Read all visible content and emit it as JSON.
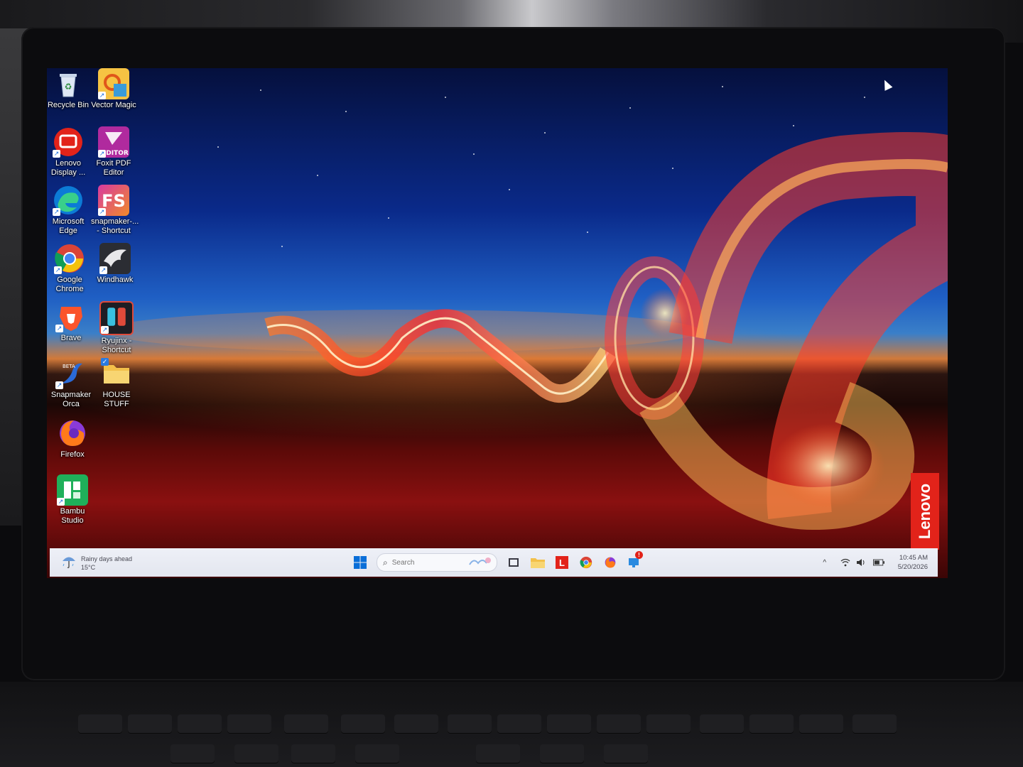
{
  "desktop": {
    "icons": [
      {
        "id": "recycle-bin",
        "label": "Recycle Bin"
      },
      {
        "id": "vector-magic",
        "label": "Vector Magic"
      },
      {
        "id": "lenovo-display",
        "label": "Lenovo Display ..."
      },
      {
        "id": "foxit-pdf-editor",
        "label": "Foxit PDF Editor"
      },
      {
        "id": "microsoft-edge",
        "label": "Microsoft Edge"
      },
      {
        "id": "snapmaker-shortcut",
        "label": "snapmaker-... - Shortcut"
      },
      {
        "id": "google-chrome",
        "label": "Google Chrome"
      },
      {
        "id": "windhawk",
        "label": "Windhawk"
      },
      {
        "id": "brave",
        "label": "Brave"
      },
      {
        "id": "ryujinx-shortcut",
        "label": "Ryujinx - Shortcut"
      },
      {
        "id": "snapmaker-orca",
        "label": "Snapmaker Orca"
      },
      {
        "id": "house-stuff",
        "label": "HOUSE STUFF"
      },
      {
        "id": "firefox",
        "label": "Firefox"
      },
      {
        "id": "bambu-studio",
        "label": "Bambu Studio"
      }
    ],
    "wallpaper_brand": "Lenovo",
    "icon_glyphs": {
      "foxit": "EDITOR",
      "snapmaker": "FS",
      "beta": "BETA"
    }
  },
  "taskbar": {
    "weather": {
      "line1": "Rainy days ahead",
      "line2": "15°C",
      "icon": "umbrella-icon"
    },
    "search_placeholder": "Search",
    "pinned": [
      {
        "name": "start-button",
        "icon": "windows-logo-icon"
      },
      {
        "name": "task-view-button",
        "icon": "task-view-icon"
      },
      {
        "name": "file-explorer-button",
        "icon": "folder-icon"
      },
      {
        "name": "lenovo-vantage-button",
        "icon": "lenovo-l-icon",
        "glyph": "L"
      },
      {
        "name": "chrome-taskbar-button",
        "icon": "chrome-icon"
      },
      {
        "name": "firefox-taskbar-button",
        "icon": "firefox-icon"
      },
      {
        "name": "remote-desktop-button",
        "icon": "monitor-alert-icon",
        "badge": "!"
      }
    ],
    "tray": {
      "chevron": "^",
      "time": "10:45 AM",
      "date": "5/20/2026"
    }
  },
  "colors": {
    "taskbar_bg": "#e6e9f1",
    "lenovo_red": "#e2231a",
    "accent_blue": "#0067c0"
  }
}
